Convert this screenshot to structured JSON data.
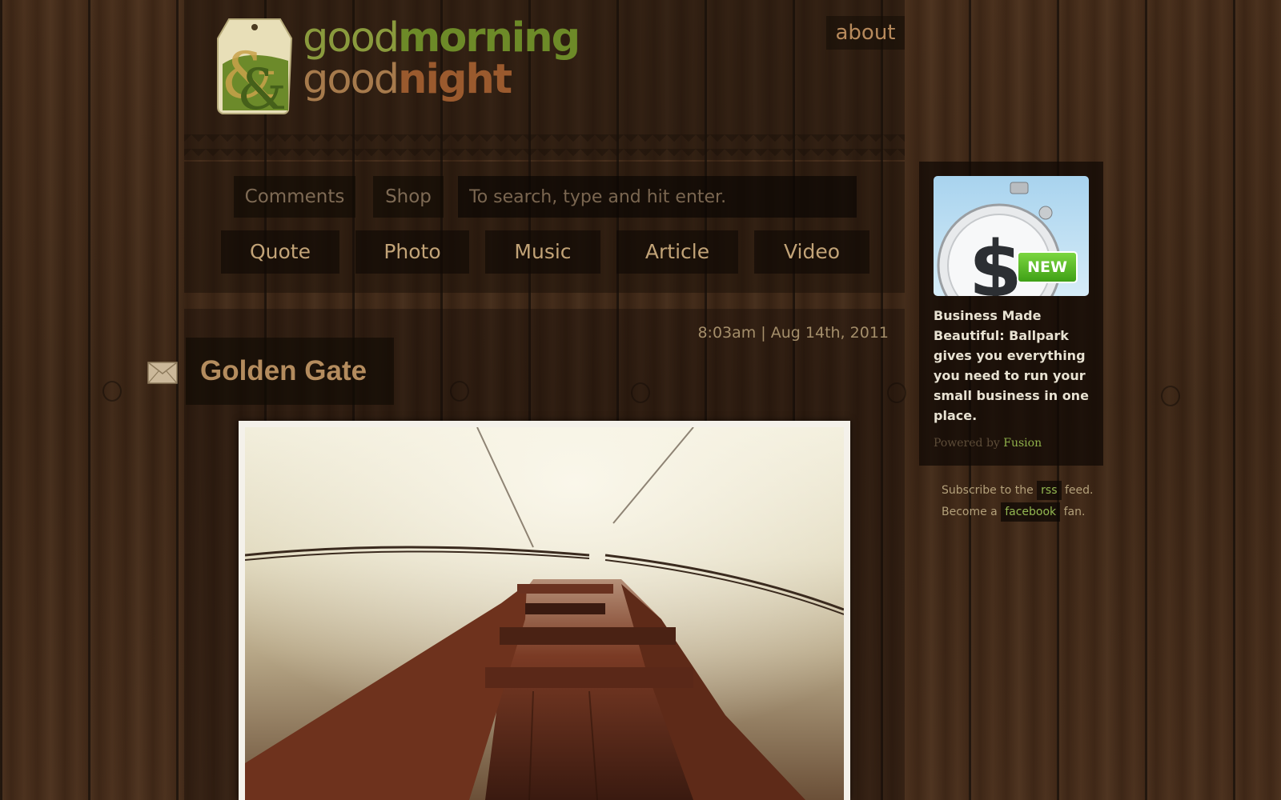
{
  "brand": {
    "line1_light": "good",
    "line1_bold": "morning",
    "line2_light": "good",
    "line2_bold": "night",
    "logo_icon": "ampersand-tag-icon",
    "colors": {
      "green": "#6d8a28",
      "brown": "#9a5a2e"
    }
  },
  "header": {
    "about_label": "about"
  },
  "nav": {
    "comments_label": "Comments",
    "shop_label": "Shop",
    "search_placeholder": "To search, type and hit enter.",
    "categories": [
      "Quote",
      "Photo",
      "Music",
      "Article",
      "Video"
    ]
  },
  "post": {
    "timestamp": "8:03am | Aug 14th, 2011",
    "title": "Golden Gate",
    "share_icon": "envelope-icon"
  },
  "sidebar": {
    "ad": {
      "badge": "NEW",
      "text": "Business Made Beautiful: Ballpark gives you everything you need to run your small business in one place.",
      "powered_prefix": "Powered by",
      "powered_link": "Fusion"
    },
    "subscribe": {
      "prefix": "Subscribe to the",
      "rss_label": "rss",
      "suffix": "feed.",
      "fb_prefix": "Become a",
      "fb_label": "facebook",
      "fb_suffix": "fan."
    }
  }
}
